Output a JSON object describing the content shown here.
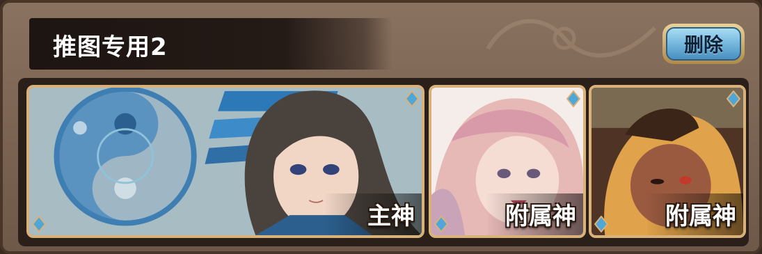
{
  "team": {
    "name": "推图专用2",
    "delete_label": "删除"
  },
  "cards": [
    {
      "role_label": "主神"
    },
    {
      "role_label": "附属神"
    },
    {
      "role_label": "附属神"
    }
  ],
  "colors": {
    "panel": "#7a6352",
    "tray": "#2b1f1a",
    "card_border": "#d8b27a",
    "delete_button": "#6fb3da",
    "gem": "#4fa6d8"
  },
  "icons": {
    "corner_gem": "blue-gem-icon",
    "main_card_emblem": "yin-yang-icon"
  }
}
